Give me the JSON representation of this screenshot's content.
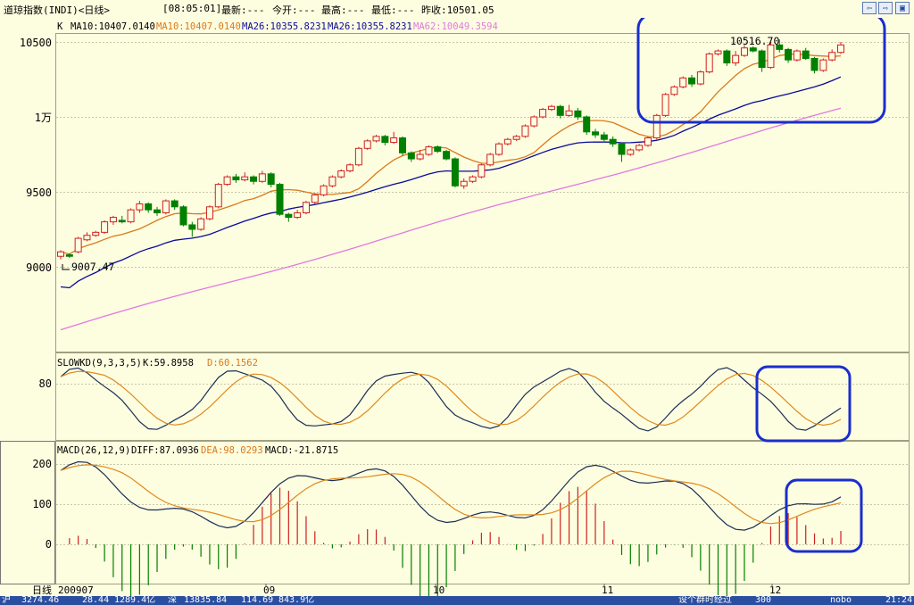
{
  "title": "道琼指数(INDI)<日线>",
  "header": {
    "time": "[08:05:01]",
    "latest": "最新:---",
    "open": "今开:---",
    "high": "最高:---",
    "low": "最低:---",
    "prev_close": "昨收:10501.05"
  },
  "nav_icons": [
    "left-arrow-icon",
    "right-arrow-icon",
    "restore-icon"
  ],
  "colors": {
    "background": "#fdfde0",
    "up_candle": "#d02020",
    "down_candle": "#008000",
    "ma10": "#d97a1a",
    "ma26": "#0a0a9a",
    "ma62": "#e07ae0",
    "k_line": "#1c2e56",
    "d_line": "#e08a1c",
    "highlight": "#1a2ecc"
  },
  "main_panel": {
    "legend": {
      "k": "K",
      "ma10_black": "MA10:10407.0140",
      "ma10": "MA10:10407.0140",
      "ma26_black": "MA26:10355.8231",
      "ma26": "MA26:10355.8231",
      "ma62": "MA62:10049.3594"
    },
    "y_ticks": [
      "10500",
      "1万",
      "9500",
      "9000"
    ],
    "max_label": "10516.70",
    "min_label": "9007.47"
  },
  "kd_panel": {
    "legend": {
      "name": "SLOWKD(9,3,3,5)",
      "k": "K:59.8958",
      "d": "D:60.1562"
    },
    "y_ticks": [
      "80"
    ]
  },
  "macd_panel": {
    "legend": {
      "name": "MACD(26,12,9)",
      "diff": "DIFF:87.0936",
      "dea": "DEA:98.0293",
      "macd": "MACD:-21.8715"
    },
    "y_ticks": [
      "200",
      "100",
      "0"
    ]
  },
  "x_axis": {
    "period_label": "日线",
    "labels": [
      "200907",
      "09",
      "10",
      "11",
      "12"
    ]
  },
  "bottom_bar": {
    "items": [
      "沪",
      "3274.46",
      "28.44",
      "1289.4亿",
      "深",
      "13835.84",
      "114.69",
      "843.9亿",
      "设个群时经过",
      "300",
      "nobo",
      "21:24"
    ]
  },
  "chart_data": [
    {
      "type": "candlestick",
      "title": "道琼指数(INDI)<日线>",
      "x_labels": [
        "200907",
        "09",
        "10",
        "11",
        "12"
      ],
      "y_ticks": [
        9000,
        9500,
        10000,
        10500
      ],
      "annotations": {
        "high": 10516.7,
        "low": 9007.47
      },
      "series": [
        {
          "name": "MA10",
          "last": 10407.014
        },
        {
          "name": "MA26",
          "last": 10355.8231
        },
        {
          "name": "MA62",
          "last": 10049.3594
        }
      ],
      "candles": [
        [
          9070,
          9100,
          9050,
          9110
        ],
        [
          9080,
          9070,
          9060,
          9090
        ],
        [
          9100,
          9190,
          9090,
          9200
        ],
        [
          9180,
          9210,
          9170,
          9230
        ],
        [
          9210,
          9230,
          9200,
          9240
        ],
        [
          9230,
          9300,
          9220,
          9310
        ],
        [
          9300,
          9330,
          9280,
          9340
        ],
        [
          9310,
          9300,
          9290,
          9340
        ],
        [
          9300,
          9380,
          9290,
          9390
        ],
        [
          9380,
          9420,
          9360,
          9440
        ],
        [
          9420,
          9380,
          9360,
          9430
        ],
        [
          9380,
          9360,
          9340,
          9400
        ],
        [
          9360,
          9440,
          9350,
          9450
        ],
        [
          9440,
          9400,
          9380,
          9450
        ],
        [
          9400,
          9280,
          9270,
          9410
        ],
        [
          9280,
          9250,
          9200,
          9300
        ],
        [
          9250,
          9320,
          9240,
          9330
        ],
        [
          9320,
          9400,
          9310,
          9410
        ],
        [
          9400,
          9550,
          9390,
          9560
        ],
        [
          9550,
          9600,
          9540,
          9610
        ],
        [
          9600,
          9580,
          9560,
          9620
        ],
        [
          9580,
          9600,
          9570,
          9630
        ],
        [
          9600,
          9570,
          9550,
          9610
        ],
        [
          9570,
          9620,
          9560,
          9640
        ],
        [
          9620,
          9550,
          9530,
          9630
        ],
        [
          9550,
          9350,
          9340,
          9560
        ],
        [
          9350,
          9330,
          9300,
          9360
        ],
        [
          9330,
          9360,
          9320,
          9380
        ],
        [
          9360,
          9430,
          9350,
          9440
        ],
        [
          9430,
          9480,
          9420,
          9490
        ],
        [
          9480,
          9540,
          9470,
          9550
        ],
        [
          9540,
          9600,
          9530,
          9610
        ],
        [
          9600,
          9640,
          9590,
          9650
        ],
        [
          9640,
          9680,
          9630,
          9690
        ],
        [
          9680,
          9790,
          9670,
          9800
        ],
        [
          9790,
          9840,
          9780,
          9850
        ],
        [
          9840,
          9870,
          9830,
          9880
        ],
        [
          9870,
          9830,
          9810,
          9880
        ],
        [
          9830,
          9860,
          9820,
          9900
        ],
        [
          9860,
          9760,
          9740,
          9870
        ],
        [
          9760,
          9720,
          9700,
          9770
        ],
        [
          9720,
          9750,
          9710,
          9780
        ],
        [
          9750,
          9800,
          9740,
          9810
        ],
        [
          9800,
          9770,
          9760,
          9810
        ],
        [
          9770,
          9720,
          9710,
          9780
        ],
        [
          9720,
          9540,
          9530,
          9730
        ],
        [
          9540,
          9570,
          9520,
          9590
        ],
        [
          9570,
          9600,
          9560,
          9610
        ],
        [
          9600,
          9680,
          9590,
          9690
        ],
        [
          9680,
          9750,
          9670,
          9760
        ],
        [
          9750,
          9820,
          9740,
          9830
        ],
        [
          9820,
          9850,
          9810,
          9860
        ],
        [
          9850,
          9870,
          9840,
          9880
        ],
        [
          9870,
          9940,
          9860,
          9950
        ],
        [
          9940,
          10000,
          9930,
          10010
        ],
        [
          10000,
          10050,
          9990,
          10060
        ],
        [
          10050,
          10070,
          10040,
          10080
        ],
        [
          10070,
          10010,
          9990,
          10080
        ],
        [
          10010,
          10040,
          10000,
          10080
        ],
        [
          10040,
          10000,
          9980,
          10060
        ],
        [
          10000,
          9900,
          9880,
          10010
        ],
        [
          9900,
          9880,
          9860,
          9920
        ],
        [
          9880,
          9850,
          9830,
          9900
        ],
        [
          9850,
          9820,
          9800,
          9870
        ],
        [
          9820,
          9750,
          9700,
          9830
        ],
        [
          9750,
          9780,
          9740,
          9790
        ],
        [
          9780,
          9810,
          9770,
          9820
        ],
        [
          9810,
          9860,
          9800,
          9870
        ],
        [
          9860,
          10010,
          9850,
          10020
        ],
        [
          10010,
          10150,
          10000,
          10160
        ],
        [
          10150,
          10200,
          10140,
          10210
        ],
        [
          10200,
          10260,
          10190,
          10270
        ],
        [
          10260,
          10220,
          10200,
          10280
        ],
        [
          10220,
          10300,
          10210,
          10310
        ],
        [
          10300,
          10420,
          10290,
          10430
        ],
        [
          10420,
          10440,
          10410,
          10450
        ],
        [
          10440,
          10360,
          10340,
          10450
        ],
        [
          10360,
          10410,
          10340,
          10440
        ],
        [
          10410,
          10460,
          10400,
          10480
        ],
        [
          10460,
          10440,
          10430,
          10470
        ],
        [
          10440,
          10330,
          10300,
          10450
        ],
        [
          10330,
          10480,
          10320,
          10500
        ],
        [
          10480,
          10450,
          10430,
          10516.7
        ],
        [
          10450,
          10380,
          10360,
          10460
        ],
        [
          10380,
          10440,
          10370,
          10450
        ],
        [
          10440,
          10390,
          10380,
          10460
        ],
        [
          10390,
          10310,
          10290,
          10400
        ],
        [
          10310,
          10380,
          10300,
          10390
        ],
        [
          10380,
          10430,
          10370,
          10450
        ],
        [
          10430,
          10480,
          10420,
          10500
        ]
      ]
    },
    {
      "type": "line",
      "title": "SLOWKD(9,3,3,5)",
      "series": [
        {
          "name": "K",
          "last": 59.8958
        },
        {
          "name": "D",
          "last": 60.1562
        }
      ],
      "y_ticks": [
        80
      ]
    },
    {
      "type": "bar",
      "title": "MACD(26,12,9)",
      "series": [
        {
          "name": "DIFF",
          "last": 87.0936
        },
        {
          "name": "DEA",
          "last": 98.0293
        },
        {
          "name": "MACD",
          "last": -21.8715
        }
      ],
      "y_ticks": [
        0,
        100,
        200
      ]
    }
  ]
}
